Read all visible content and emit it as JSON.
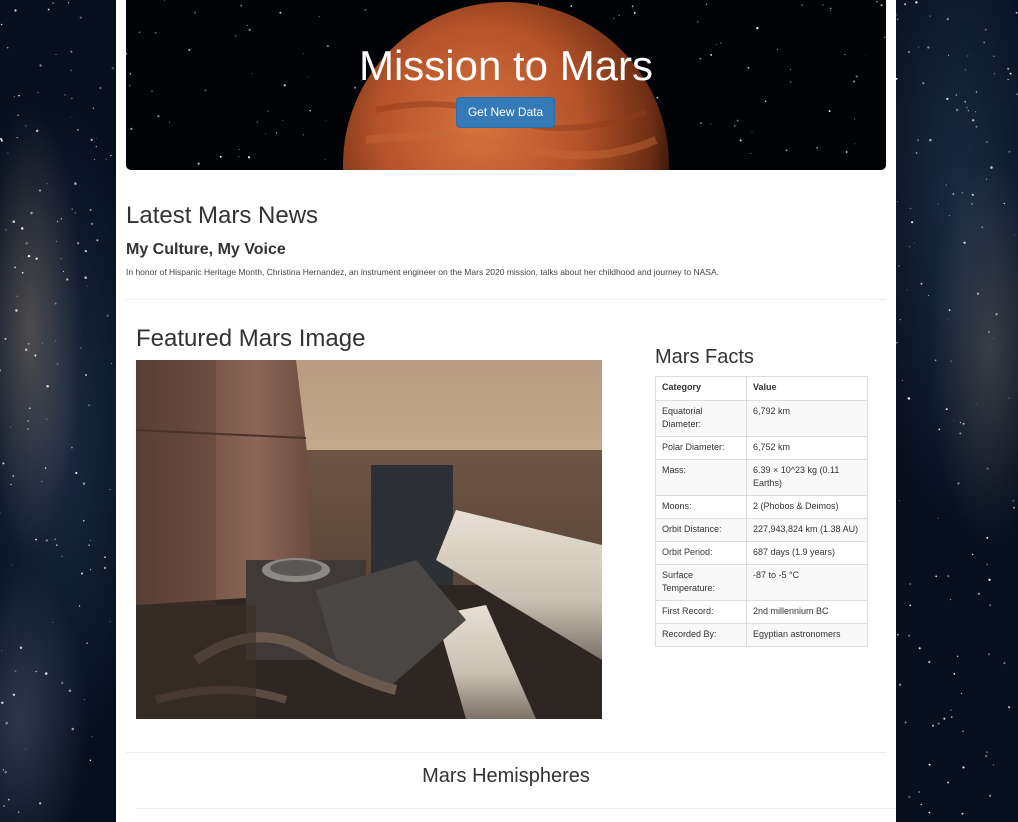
{
  "jumbotron": {
    "title": "Mission to Mars",
    "button_label": "Get New Data"
  },
  "news": {
    "section_title": "Latest Mars News",
    "title": "My Culture, My Voice",
    "paragraph": "In honor of Hispanic Heritage Month, Christina Hernandez, an instrument engineer on the Mars 2020 mission, talks about her childhood and journey to NASA."
  },
  "featured_image": {
    "section_title": "Featured Mars Image"
  },
  "facts": {
    "section_title": "Mars Facts",
    "headers": [
      "Category",
      "Value"
    ],
    "rows": [
      [
        "Equatorial Diameter:",
        "6,792 km"
      ],
      [
        "Polar Diameter:",
        "6,752 km"
      ],
      [
        "Mass:",
        "6.39 × 10^23 kg (0.11 Earths)"
      ],
      [
        "Moons:",
        "2 (Phobos & Deimos)"
      ],
      [
        "Orbit Distance:",
        "227,943,824 km (1.38 AU)"
      ],
      [
        "Orbit Period:",
        "687 days (1.9 years)"
      ],
      [
        "Surface Temperature:",
        "-87 to -5 °C"
      ],
      [
        "First Record:",
        "2nd millennium BC"
      ],
      [
        "Recorded By:",
        "Egyptian astronomers"
      ]
    ]
  },
  "hemispheres": {
    "section_title": "Mars Hemispheres"
  },
  "colors": {
    "button": "#337ab7",
    "background": "#07101f",
    "mars": "#b5532a"
  }
}
